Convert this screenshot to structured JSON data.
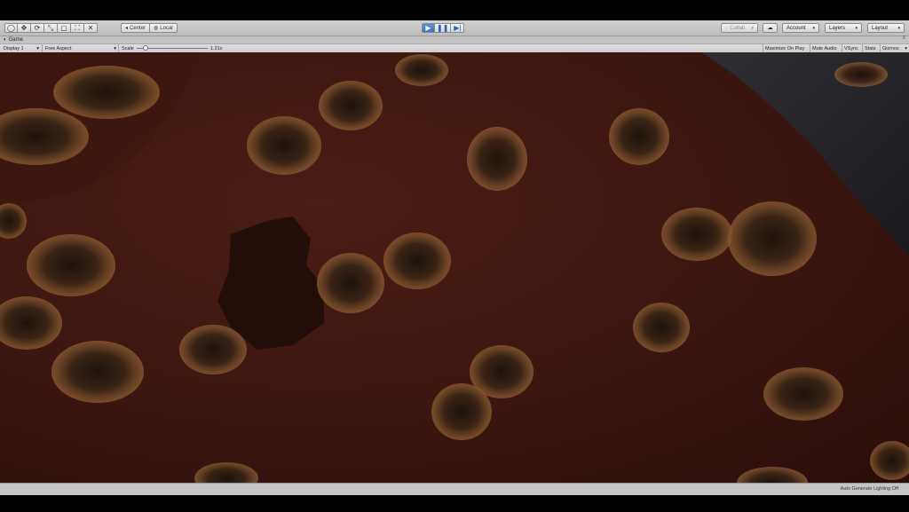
{
  "toolbar": {
    "transform_tools": [
      {
        "icon": "hand-icon",
        "glyph": "✋"
      },
      {
        "icon": "move-icon",
        "glyph": "✥"
      },
      {
        "icon": "rotate-icon",
        "glyph": "⟳"
      },
      {
        "icon": "scale-icon",
        "glyph": "⤡"
      },
      {
        "icon": "rect-tool-icon",
        "glyph": "▢"
      },
      {
        "icon": "transform-tool-icon",
        "glyph": "⛶"
      },
      {
        "icon": "custom-tool-icon",
        "glyph": "✕"
      }
    ],
    "pivot_label": "Center",
    "space_label": "Local",
    "collab_label": "Collab",
    "account_label": "Account",
    "layers_label": "Layers",
    "layout_label": "Layout"
  },
  "tab": {
    "label": "Game"
  },
  "game_bar": {
    "display": "Display 1",
    "aspect": "Free Aspect",
    "scale_label": "Scale",
    "scale_value": "1.21x",
    "scale_fraction": 0.13,
    "maximize_on_play": "Maximize On Play",
    "mute_audio": "Mute Audio",
    "vsync": "VSync",
    "stats": "Stats",
    "gizmos": "Gizmos"
  },
  "status_bar": {
    "text": "Auto Generate Lighting Off"
  },
  "colors": {
    "accent": "#3a6fbe",
    "terrain": "#4a1d14",
    "foliage": "#9a6a3a"
  }
}
